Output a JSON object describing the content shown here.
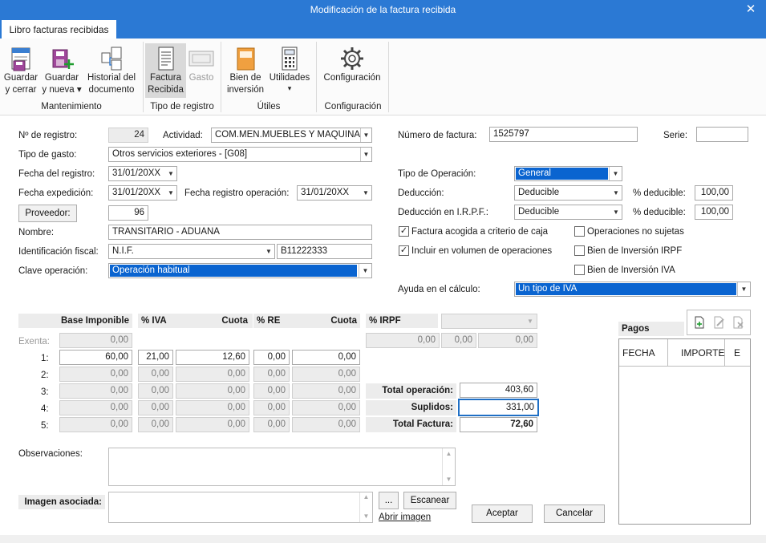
{
  "window": {
    "title": "Modificación de la factura recibida",
    "close": "✕"
  },
  "tab": "Libro facturas recibidas",
  "ribbon": {
    "save_close": [
      "Guardar",
      "y cerrar"
    ],
    "save_new": [
      "Guardar",
      "y nueva ▾"
    ],
    "history": [
      "Historial del",
      "documento"
    ],
    "factura": [
      "Factura",
      "Recibida"
    ],
    "gasto": "Gasto",
    "bien": [
      "Bien de",
      "inversión"
    ],
    "utilidades": [
      "Utilidades",
      "▾"
    ],
    "config": "Configuración",
    "groups": {
      "mantenimiento": "Mantenimiento",
      "tipo": "Tipo de registro",
      "utiles": "Útiles",
      "config": "Configuración"
    }
  },
  "left": {
    "registro_label": "Nº de registro:",
    "registro": "24",
    "actividad_label": "Actividad:",
    "actividad": "COM.MEN.MUEBLES Y MAQUINAS I",
    "tipo_gasto_label": "Tipo de gasto:",
    "tipo_gasto": "Otros servicios exteriores - [G08]",
    "fecha_registro_label": "Fecha del registro:",
    "fecha_registro": "31/01/20XX",
    "fecha_exp_label": "Fecha expedición:",
    "fecha_exp": "31/01/20XX",
    "fecha_reg_op_label": "Fecha registro operación:",
    "fecha_reg_op": "31/01/20XX",
    "proveedor_btn": "Proveedor:",
    "proveedor": "96",
    "nombre_label": "Nombre:",
    "nombre": "TRANSITARIO - ADUANA",
    "id_fiscal_label": "Identificación fiscal:",
    "id_tipo": "N.I.F.",
    "id_num": "B11222333",
    "clave_label": "Clave operación:",
    "clave": "Operación habitual"
  },
  "right": {
    "num_factura_label": "Número de factura:",
    "num_factura": "1525797",
    "serie_label": "Serie:",
    "serie": "",
    "tipo_op_label": "Tipo de Operación:",
    "tipo_op": "General",
    "deduccion_label": "Deducción:",
    "deduccion": "Deducible",
    "pct_ded_label": "% deducible:",
    "pct_ded": "100,00",
    "deduccion_irpf_label": "Deducción en I.R.P.F.:",
    "deduccion_irpf": "Deducible",
    "pct_ded2_label": "% deducible:",
    "pct_ded2": "100,00",
    "chk_caja": "Factura acogida a criterio de caja",
    "chk_volumen": "Incluir en  volumen de operaciones",
    "chk_no_sujetas": "Operaciones no sujetas",
    "chk_irpf": "Bien de Inversión IRPF",
    "chk_iva": "Bien de Inversión IVA",
    "ayuda_label": "Ayuda en el cálculo:",
    "ayuda": "Un tipo de IVA"
  },
  "iva": {
    "headers": [
      "Base Imponible",
      "% IVA",
      "Cuota",
      "% RE",
      "Cuota",
      "% IRPF"
    ],
    "exenta_label": "Exenta:",
    "exenta": "0,00",
    "rows": [
      {
        "label": "1:",
        "base": "60,00",
        "iva": "21,00",
        "cuota": "12,60",
        "re": "0,00",
        "cuota_re": "0,00"
      },
      {
        "label": "2:",
        "base": "0,00",
        "iva": "0,00",
        "cuota": "0,00",
        "re": "0,00",
        "cuota_re": "0,00"
      },
      {
        "label": "3:",
        "base": "0,00",
        "iva": "0,00",
        "cuota": "0,00",
        "re": "0,00",
        "cuota_re": "0,00"
      },
      {
        "label": "4:",
        "base": "0,00",
        "iva": "0,00",
        "cuota": "0,00",
        "re": "0,00",
        "cuota_re": "0,00"
      },
      {
        "label": "5:",
        "base": "0,00",
        "iva": "0,00",
        "cuota": "0,00",
        "re": "0,00",
        "cuota_re": "0,00"
      }
    ],
    "irpf": [
      "0,00",
      "0,00",
      "0,00"
    ]
  },
  "totals": {
    "operacion_label": "Total operación:",
    "operacion": "403,60",
    "suplidos_label": "Suplidos:",
    "suplidos": "331,00",
    "factura_label": "Total Factura:",
    "factura": "72,60"
  },
  "pagos": {
    "title": "Pagos",
    "cols": [
      "FECHA",
      "IMPORTE",
      "E"
    ]
  },
  "observaciones_label": "Observaciones:",
  "imagen_label": "Imagen asociada:",
  "dots_btn": "...",
  "escanear_btn": "Escanear",
  "abrir_link": "Abrir imagen",
  "aceptar_btn": "Aceptar",
  "cancelar_btn": "Cancelar"
}
